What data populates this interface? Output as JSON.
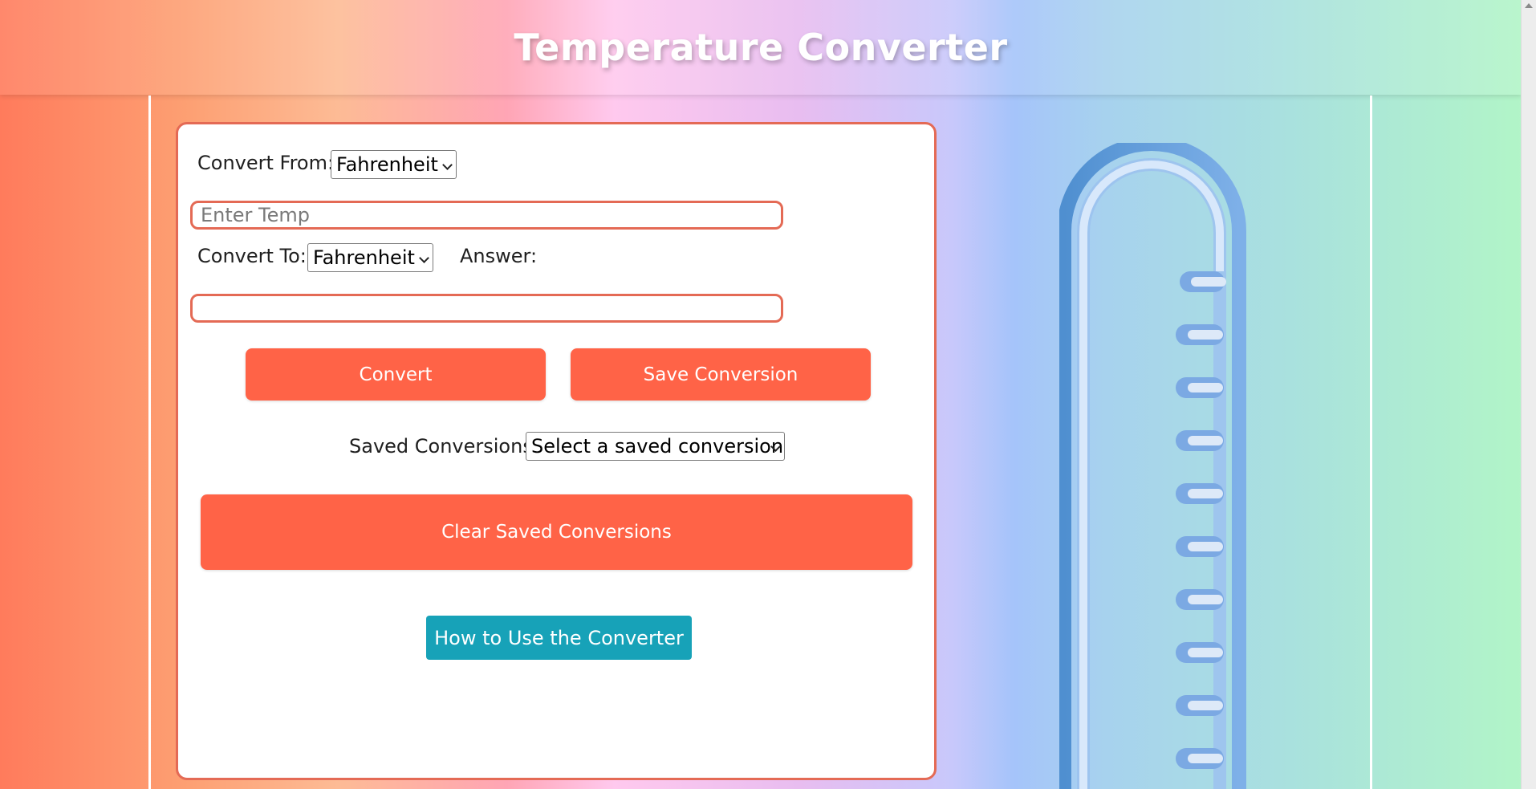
{
  "header": {
    "title": "Temperature Converter"
  },
  "form": {
    "from_label": "Convert From:",
    "from_value": "Fahrenheit",
    "temp_placeholder": "Enter Temp",
    "to_label": "Convert To:",
    "to_value": "Fahrenheit",
    "answer_label": "Answer:",
    "answer_value": ""
  },
  "buttons": {
    "convert": "Convert",
    "save": "Save Conversion",
    "clear": "Clear Saved Conversions",
    "help": "How to Use the Converter"
  },
  "saved": {
    "label": "Saved Conversions:",
    "selected": "Select a saved conversion"
  },
  "colors": {
    "accent": "#ff6347",
    "card_border": "#e46a55",
    "help_button": "#17a2b8",
    "thermometer": "#5b9bd5"
  },
  "icons": {
    "thermometer": "thermometer-icon",
    "dropdown": "chevron-down-icon"
  }
}
